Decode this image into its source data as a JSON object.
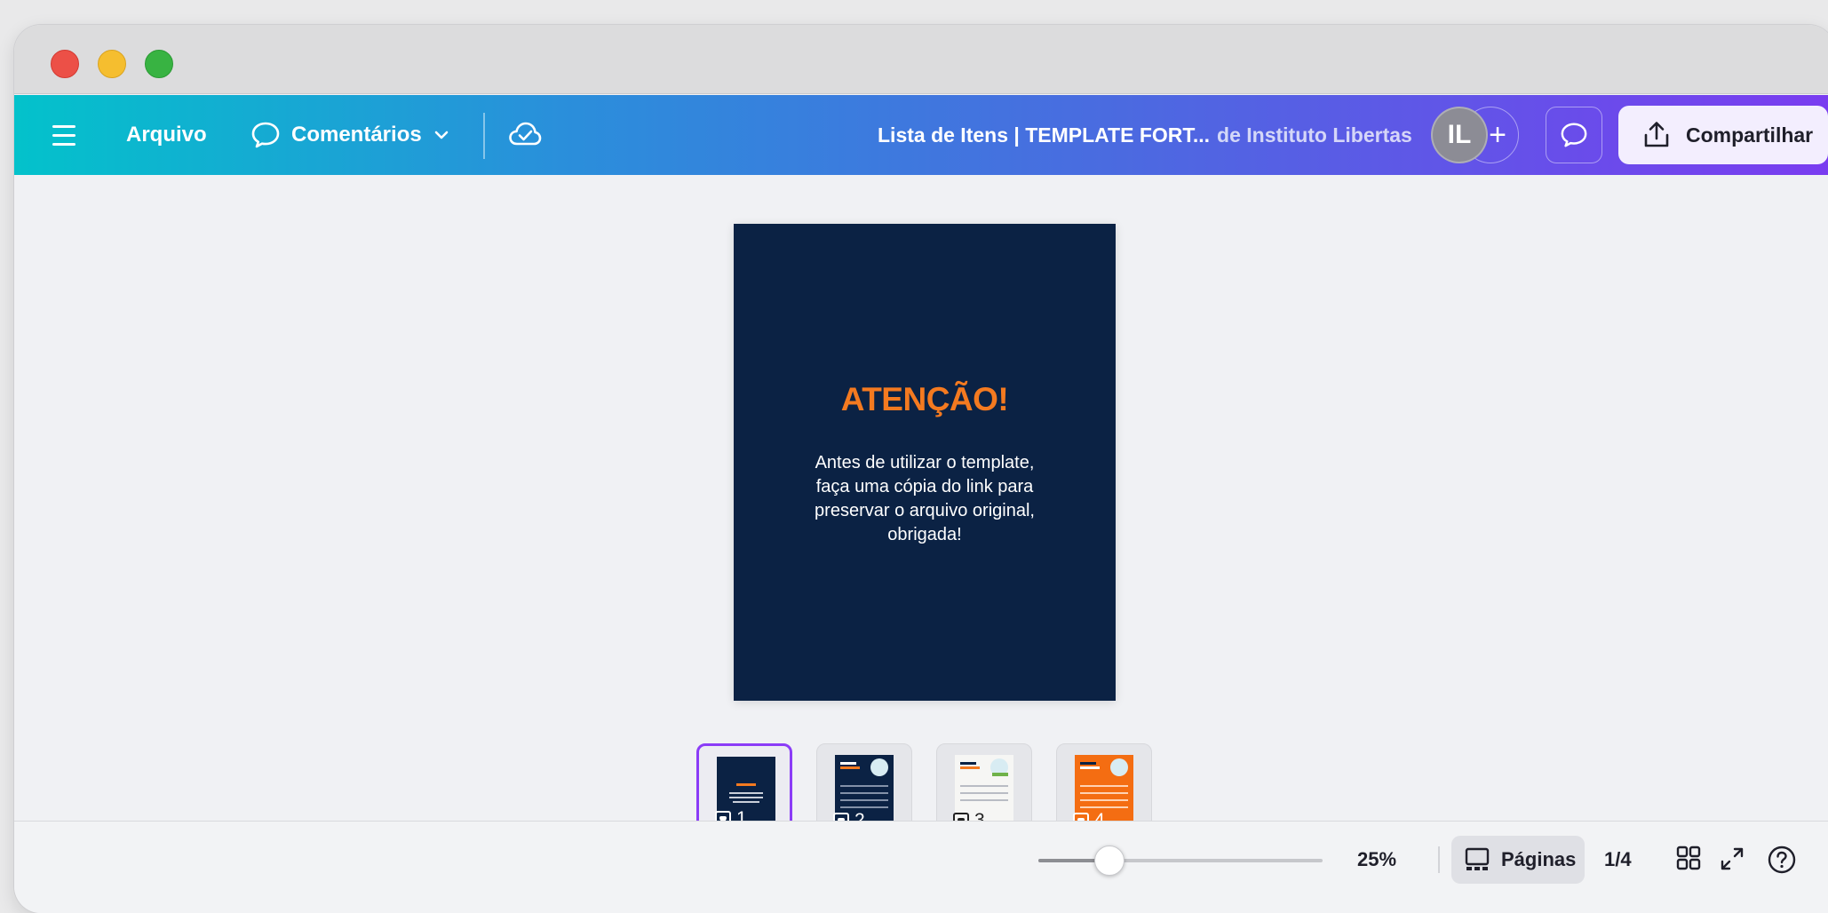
{
  "toolbar": {
    "file_label": "Arquivo",
    "comments_label": "Comentários",
    "doc_title": "Lista de Itens | TEMPLATE FORT...",
    "doc_owner": "de Instituto Libertas",
    "avatar_initials": "IL",
    "add_label": "+",
    "share_label": "Compartilhar"
  },
  "page": {
    "heading": "ATENÇÃO!",
    "body": "Antes de utilizar o template, faça uma cópia do link para preservar o arquivo original, obrigada!",
    "background": "#0b2244",
    "heading_color": "#f47a20"
  },
  "thumbnails": [
    {
      "number": "1",
      "selected": true
    },
    {
      "number": "2",
      "selected": false
    },
    {
      "number": "3",
      "selected": false
    },
    {
      "number": "4",
      "selected": false
    }
  ],
  "bottom": {
    "zoom_percent": 25,
    "zoom_label": "25%",
    "pages_label": "Páginas",
    "page_count": "1/4"
  },
  "colors": {
    "accent": "#8b3cf7",
    "toolbar_gradient": [
      "#03c2cb",
      "#2a8fdb",
      "#4a6be0",
      "#7a3cf0"
    ]
  }
}
